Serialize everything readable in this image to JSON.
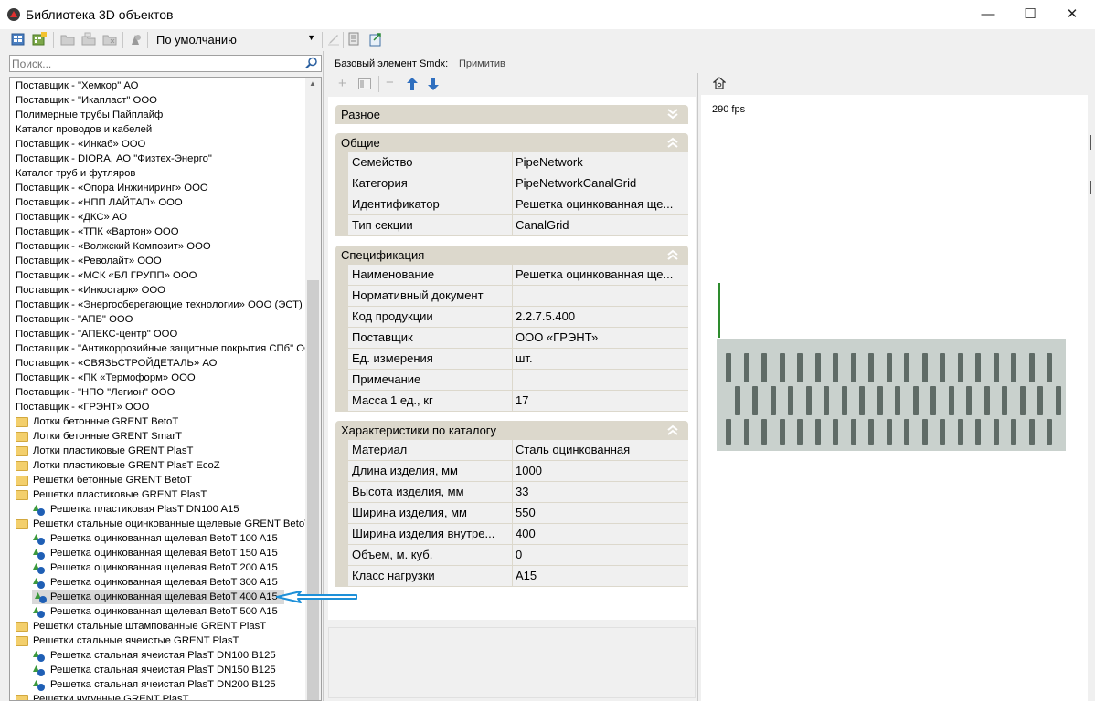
{
  "window": {
    "title": "Библиотека 3D объектов",
    "controls": {
      "minimize": "—",
      "maximize": "☐",
      "close": "✕"
    }
  },
  "toolbar": {
    "preset": "По умолчанию"
  },
  "search": {
    "placeholder": "Поиск..."
  },
  "tree": {
    "items": [
      {
        "label": "Поставщик - \"Хемкор\" АО",
        "type": "root",
        "level": 0
      },
      {
        "label": "Поставщик - \"Икапласт\" ООО",
        "type": "root",
        "level": 0
      },
      {
        "label": "Полимерные трубы Пайплайф",
        "type": "root",
        "level": 0
      },
      {
        "label": "Каталог проводов и кабелей",
        "type": "root",
        "level": 0
      },
      {
        "label": "Поставщик - «Инкаб» ООО",
        "type": "root",
        "level": 0
      },
      {
        "label": "Поставщик - DIORA, АО \"Физтех-Энерго\"",
        "type": "root",
        "level": 0
      },
      {
        "label": "Каталог труб и футляров",
        "type": "root",
        "level": 0
      },
      {
        "label": "Поставщик - «Опора Инжиниринг» ООО",
        "type": "root",
        "level": 0
      },
      {
        "label": "Поставщик - «НПП ЛАЙТАП» ООО",
        "type": "root",
        "level": 0
      },
      {
        "label": "Поставщик - «ДКС» АО",
        "type": "root",
        "level": 0
      },
      {
        "label": "Поставщик - «ТПК «Вартон» ООО",
        "type": "root",
        "level": 0
      },
      {
        "label": "Поставщик - «Волжский Композит» ООО",
        "type": "root",
        "level": 0
      },
      {
        "label": "Поставщик - «Револайт» ООО",
        "type": "root",
        "level": 0
      },
      {
        "label": "Поставщик - «МСК «БЛ ГРУПП» ООО",
        "type": "root",
        "level": 0
      },
      {
        "label": "Поставщик - «Инкостарк» ООО",
        "type": "root",
        "level": 0
      },
      {
        "label": "Поставщик - «Энергосберегающие технологии» ООО (ЭСТ)",
        "type": "root",
        "level": 0
      },
      {
        "label": "Поставщик - \"АПБ\" ООО",
        "type": "root",
        "level": 0
      },
      {
        "label": "Поставщик - \"АПЕКС-центр\" ООО",
        "type": "root",
        "level": 0
      },
      {
        "label": "Поставщик - \"Антикоррозийные защитные покрытия СПб\" ООО",
        "type": "root",
        "level": 0
      },
      {
        "label": "Поставщик - «СВЯЗЬСТРОЙДЕТАЛЬ» АО",
        "type": "root",
        "level": 0
      },
      {
        "label": "Поставщик - «ПК «Термоформ» ООО",
        "type": "root",
        "level": 0
      },
      {
        "label": "Поставщик - \"НПО \"Легион\" ООО",
        "type": "root",
        "level": 0
      },
      {
        "label": "Поставщик - «ГРЭНТ» ООО",
        "type": "root",
        "level": 0
      },
      {
        "label": "Лотки бетонные GRENT BetoT",
        "type": "folder",
        "level": 1
      },
      {
        "label": "Лотки бетонные GRENT SmarT",
        "type": "folder",
        "level": 1
      },
      {
        "label": "Лотки пластиковые GRENT PlasT",
        "type": "folder",
        "level": 1
      },
      {
        "label": "Лотки пластиковые GRENT PlasT EcoZ",
        "type": "folder",
        "level": 1
      },
      {
        "label": "Решетки бетонные GRENT BetoT",
        "type": "folder",
        "level": 1
      },
      {
        "label": "Решетки пластиковые GRENT PlasT",
        "type": "folder",
        "level": 1
      },
      {
        "label": "Решетка пластиковая  PlasT DN100 A15",
        "type": "object",
        "level": 2
      },
      {
        "label": "Решетки стальные оцинкованные щелевые GRENT BetoT",
        "type": "folder",
        "level": 1
      },
      {
        "label": "Решетка оцинкованная щелевая BetoT 100 A15",
        "type": "object",
        "level": 2
      },
      {
        "label": "Решетка оцинкованная щелевая BetoT 150 A15",
        "type": "object",
        "level": 2
      },
      {
        "label": "Решетка оцинкованная щелевая BetoT 200 A15",
        "type": "object",
        "level": 2
      },
      {
        "label": "Решетка оцинкованная щелевая BetoT 300 A15",
        "type": "object",
        "level": 2
      },
      {
        "label": "Решетка оцинкованная щелевая BetoT 400 A15",
        "type": "object",
        "level": 2,
        "selected": true
      },
      {
        "label": "Решетка оцинкованная щелевая BetoT 500 A15",
        "type": "object",
        "level": 2
      },
      {
        "label": "Решетки стальные штампованные GRENT PlasT",
        "type": "folder",
        "level": 1
      },
      {
        "label": "Решетки стальные ячеистые GRENT PlasT",
        "type": "folder",
        "level": 1
      },
      {
        "label": "Решетка стальная ячеистая PlasT DN100 B125",
        "type": "object",
        "level": 2
      },
      {
        "label": "Решетка стальная ячеистая PlasT DN150 B125",
        "type": "object",
        "level": 2
      },
      {
        "label": "Решетка стальная ячеистая PlasT DN200 B125",
        "type": "object",
        "level": 2
      },
      {
        "label": "Решетки чугунные GRENT PlasT",
        "type": "folder",
        "level": 1
      }
    ]
  },
  "properties": {
    "base_label": "Базовый элемент Smdx:",
    "base_value": "Примитив",
    "sections": [
      {
        "title": "Разное",
        "expanded": false,
        "rows": []
      },
      {
        "title": "Общие",
        "expanded": true,
        "rows": [
          {
            "name": "Семейство",
            "value": "PipeNetwork"
          },
          {
            "name": "Категория",
            "value": "PipeNetworkCanalGrid"
          },
          {
            "name": "Идентификатор",
            "value": "Решетка оцинкованная ще..."
          },
          {
            "name": "Тип секции",
            "value": "CanalGrid"
          }
        ]
      },
      {
        "title": "Спецификация",
        "expanded": true,
        "rows": [
          {
            "name": "Наименование",
            "value": "Решетка оцинкованная ще..."
          },
          {
            "name": "Нормативный документ",
            "value": ""
          },
          {
            "name": "Код продукции",
            "value": "2.2.7.5.400"
          },
          {
            "name": "Поставщик",
            "value": "ООО «ГРЭНТ»"
          },
          {
            "name": "Ед. измерения",
            "value": "шт."
          },
          {
            "name": "Примечание",
            "value": ""
          },
          {
            "name": "Масса 1 ед., кг",
            "value": "17"
          }
        ]
      },
      {
        "title": "Характеристики по каталогу",
        "expanded": true,
        "rows": [
          {
            "name": "Материал",
            "value": "Сталь оцинкованная"
          },
          {
            "name": "Длина изделия, мм",
            "value": "1000"
          },
          {
            "name": "Высота изделия, мм",
            "value": "33"
          },
          {
            "name": "Ширина изделия, мм",
            "value": "550"
          },
          {
            "name": "Ширина изделия внутре...",
            "value": "400"
          },
          {
            "name": "Объем, м. куб.",
            "value": "0"
          },
          {
            "name": "Класс нагрузки",
            "value": "A15"
          }
        ]
      }
    ]
  },
  "viewport": {
    "fps": "290 fps",
    "grate_color": "#c9d1cd",
    "slot_color": "#5f6b66",
    "axis_color": "#2e8b2e"
  },
  "colors": {
    "section_header": "#dcd8cc",
    "annotation_arrow": "#1e90d8"
  }
}
